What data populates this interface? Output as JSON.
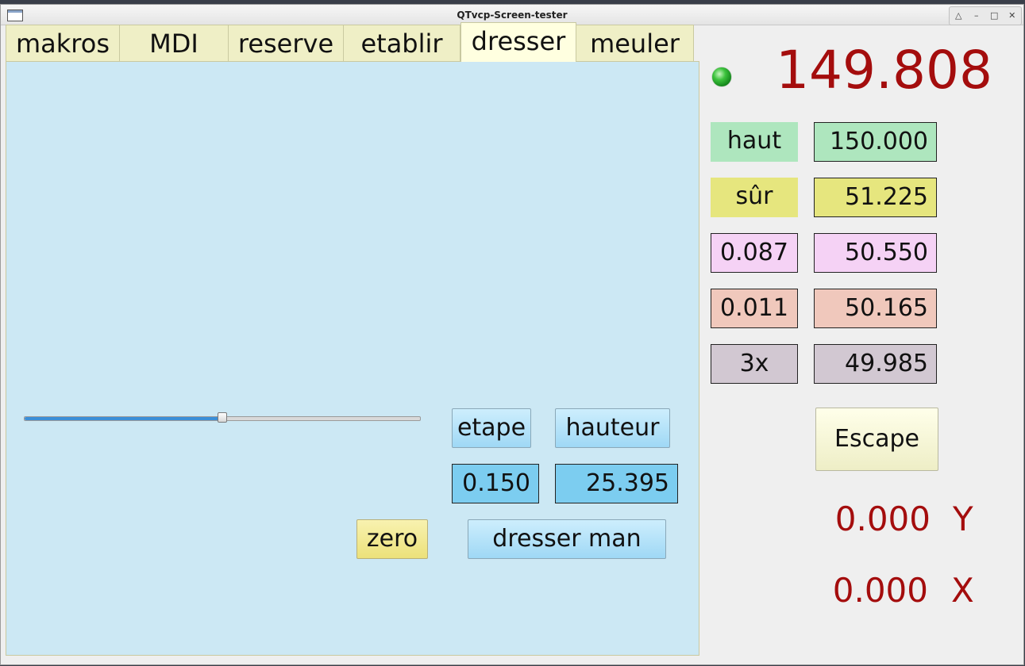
{
  "window": {
    "title": "QTvcp-Screen-tester"
  },
  "tabs": [
    "makros",
    "MDI",
    "reserve",
    "etablir",
    "dresser",
    "meuler"
  ],
  "active_tab": "dresser",
  "dresser_panel": {
    "slider_fraction": 0.5,
    "etape_label": "etape",
    "hauteur_label": "hauteur",
    "etape_value": "0.150",
    "hauteur_value": "25.395",
    "zero_label": "zero",
    "dresser_man_label": "dresser man"
  },
  "status": {
    "led_color": "#22aa22",
    "main_value": "149.808"
  },
  "levels": [
    {
      "label": "haut",
      "value": "150.000",
      "color": "#aee6be",
      "label_border": false
    },
    {
      "label": "sûr",
      "value": "51.225",
      "color": "#e6e67e",
      "label_border": false
    },
    {
      "label": "0.087",
      "value": "50.550",
      "color": "#f5d2f5",
      "label_border": true
    },
    {
      "label": "0.011",
      "value": "50.165",
      "color": "#f0c8bc",
      "label_border": true
    },
    {
      "label": "3x",
      "value": "49.985",
      "color": "#d2c8d2",
      "label_border": true
    }
  ],
  "escape_label": "Escape",
  "axes": [
    {
      "value": "0.000",
      "name": "Y"
    },
    {
      "value": "0.000",
      "name": "X"
    }
  ],
  "colors": {
    "readout_red": "#a40d0d",
    "panel_blue": "#cce8f4",
    "field_blue": "#7ccdf0"
  }
}
